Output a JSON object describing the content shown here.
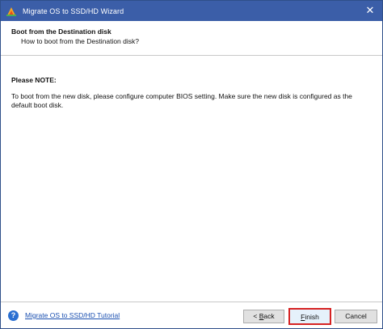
{
  "window": {
    "title": "Migrate OS to SSD/HD Wizard",
    "close_glyph": "✕"
  },
  "header": {
    "title": "Boot from the Destination disk",
    "subtitle": "How to boot from the Destination disk?"
  },
  "content": {
    "note_title": "Please NOTE:",
    "note_body": "To boot from the new disk, please configure computer BIOS setting. Make sure the new disk is configured as the default boot disk."
  },
  "footer": {
    "help_icon": "?",
    "tutorial_link": "Migrate OS to SSD/HD Tutorial",
    "back_prefix": "< ",
    "back_accel": "B",
    "back_rest": "ack",
    "finish_accel": "F",
    "finish_rest": "inish",
    "cancel_label": "Cancel"
  },
  "colors": {
    "titlebar": "#3b5ea8",
    "finish_highlight": "#d62222",
    "link": "#1a4fb0"
  }
}
